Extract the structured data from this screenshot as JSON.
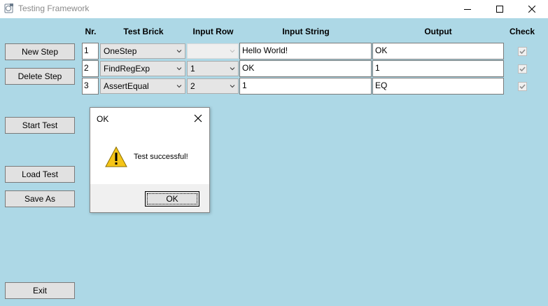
{
  "window": {
    "title": "Testing Framework",
    "icon": "app-icon"
  },
  "sidebar": {
    "new_step": "New Step",
    "delete_step": "Delete Step",
    "start_test": "Start Test",
    "load_test": "Load Test",
    "save_as": "Save As",
    "exit": "Exit"
  },
  "grid": {
    "headers": {
      "nr": "Nr.",
      "brick": "Test Brick",
      "input_row": "Input Row",
      "input_string": "Input String",
      "output": "Output",
      "check": "Check"
    },
    "rows": [
      {
        "nr": "1",
        "brick": "OneStep",
        "input_row": "",
        "input_row_disabled": true,
        "input_string": "Hello World!",
        "output": "OK",
        "checked": true
      },
      {
        "nr": "2",
        "brick": "FindRegExp",
        "input_row": "1",
        "input_row_disabled": false,
        "input_string": "OK",
        "output": "1",
        "checked": true
      },
      {
        "nr": "3",
        "brick": "AssertEqual",
        "input_row": "2",
        "input_row_disabled": false,
        "input_string": "1",
        "output": "EQ",
        "checked": true
      }
    ]
  },
  "dialog": {
    "title": "OK",
    "message": "Test successful!",
    "ok_label": "OK",
    "icon": "warning-icon"
  },
  "colors": {
    "background": "#add8e6",
    "button_face": "#e1e1e1",
    "warning": "#f5c518"
  }
}
